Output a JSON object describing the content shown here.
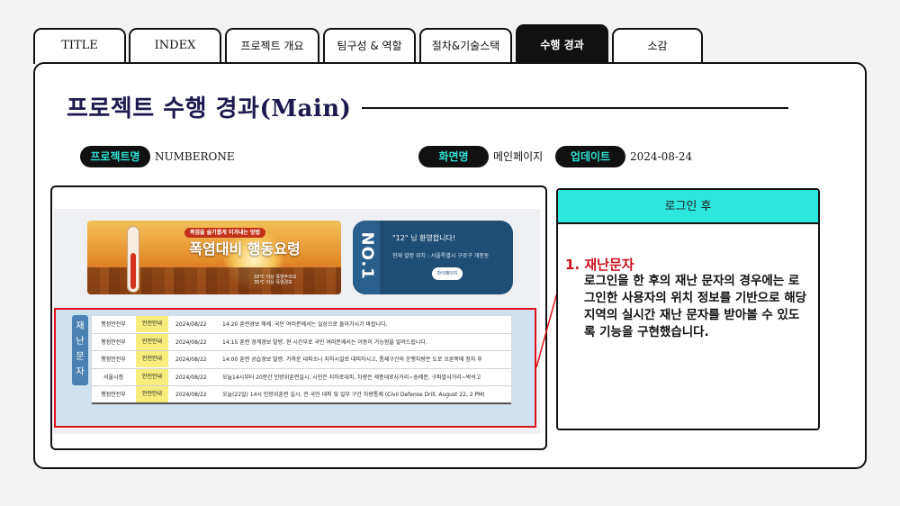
{
  "tabs": [
    {
      "label": "TITLE",
      "active": false
    },
    {
      "label": "INDEX",
      "active": false
    },
    {
      "label": "프로젝트 개요",
      "active": false
    },
    {
      "label": "팀구성 & 역할",
      "active": false
    },
    {
      "label": "절차&기술스택",
      "active": false
    },
    {
      "label": "수행 경과",
      "active": true
    },
    {
      "label": "소감",
      "active": false
    }
  ],
  "page": {
    "title": "프로젝트 수행 경과(Main)"
  },
  "info": {
    "project_label": "프로젝트명",
    "project_value": "NUMBERONE",
    "screen_label": "화면명",
    "screen_value": "메인페이지",
    "update_label": "업데이트",
    "update_value": "2024-08-24"
  },
  "screenshot": {
    "heat_banner": {
      "badge": "폭염을 슬기롭게 이겨내는 방법",
      "title": "폭염대비 행동요령",
      "small1": "33℃ 이상 폭염주의보",
      "small2": "35℃ 이상 폭염경보"
    },
    "welcome": {
      "vertical": "NO.1",
      "hello": "\"12\" 님 환영합니다!",
      "location": "현재 설정 위치 : 서울특별시 구로구 개봉동",
      "mypage_button": "마이페이지"
    },
    "disaster_label": "재난문자",
    "messages": [
      {
        "agency": "행정안전부",
        "type": "안전안내",
        "date": "2024/08/22",
        "text": "14:20 훈련경보 해제. 국민 여러분께서는 일상으로 돌아가시기 바랍니다."
      },
      {
        "agency": "행정안전부",
        "type": "안전안내",
        "date": "2024/08/22",
        "text": "14:15 훈련 경계경보 발령. 현 시간부로 국민 여러분께서는 이동이 가능함을 알려드립니다."
      },
      {
        "agency": "행정안전부",
        "type": "안전안내",
        "date": "2024/08/22",
        "text": "14:00 훈련 공습경보 발령. 가까운 대피소나 지하시설로 대피하시고, 통제구간의 운행차량은 도로 오른쪽에 정차 후"
      },
      {
        "agency": "서울시청",
        "type": "안전안내",
        "date": "2024/08/22",
        "text": "오늘14시부터 20분간 민방위훈련실시. 시민은 지하로대피, 차량은 세종대로사거리~숭례문, 구파발사거리~박석고"
      },
      {
        "agency": "행정안전부",
        "type": "안전안내",
        "date": "2024/08/22",
        "text": "오늘(22일) 14시 민방위훈련 실시, 전 국민 대피 및 일부 구간 차량통제 (Civil Defense Drill, August 22, 2 PM)"
      }
    ]
  },
  "card": {
    "header": "로그인 후",
    "heading": "1. 재난문자",
    "body": "로그인을 한 후의 재난 문자의 경우에는 로그인한 사용자의 위치 정보를 기반으로 해당 지역의 실시간 재난 문자를 받아볼 수 있도록 기능을 구현했습니다."
  },
  "colors": {
    "accent": "#2de6dc",
    "title": "#1c1a4f",
    "highlight_border": "#e0121b",
    "heading_red": "#c8101b"
  }
}
